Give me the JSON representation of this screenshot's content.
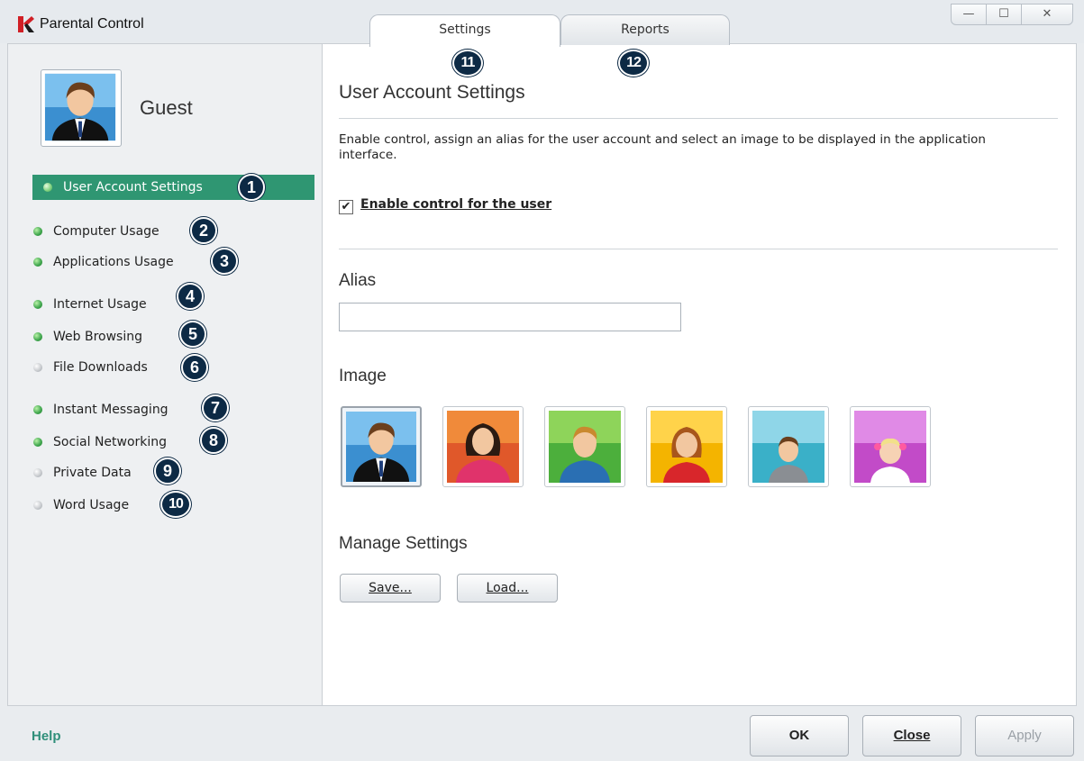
{
  "window": {
    "title": "Parental Control",
    "tabs": [
      {
        "label": "Settings",
        "badge": "11",
        "active": true
      },
      {
        "label": "Reports",
        "badge": "12",
        "active": false
      }
    ],
    "controls": {
      "minimize": "—",
      "maximize": "☐",
      "close": "✕"
    }
  },
  "sidebar": {
    "user_name": "Guest",
    "items": [
      {
        "label": "User Account Settings",
        "badge": "1",
        "status": "active"
      },
      {
        "label": "Computer Usage",
        "badge": "2",
        "status": "on"
      },
      {
        "label": "Applications Usage",
        "badge": "3",
        "status": "on"
      },
      {
        "label": "Internet Usage",
        "badge": "4",
        "status": "on"
      },
      {
        "label": "Web Browsing",
        "badge": "5",
        "status": "on"
      },
      {
        "label": "File Downloads",
        "badge": "6",
        "status": "off"
      },
      {
        "label": "Instant Messaging",
        "badge": "7",
        "status": "on"
      },
      {
        "label": "Social Networking",
        "badge": "8",
        "status": "on"
      },
      {
        "label": "Private Data",
        "badge": "9",
        "status": "off"
      },
      {
        "label": "Word Usage",
        "badge": "10",
        "status": "off"
      }
    ]
  },
  "main": {
    "title": "User Account Settings",
    "description": "Enable control, assign an alias for the user account and select an image to be displayed in the application interface.",
    "enable_control": {
      "label": "Enable control for the user",
      "checked": true,
      "check_glyph": "✔"
    },
    "alias": {
      "heading": "Alias",
      "value": ""
    },
    "image": {
      "heading": "Image",
      "options": [
        {
          "name": "man-suit",
          "bg": "#3b8fd0",
          "selected": true
        },
        {
          "name": "woman-dark-hair",
          "bg": "#e0582a",
          "selected": false
        },
        {
          "name": "boy-green",
          "bg": "#4caf3c",
          "selected": false
        },
        {
          "name": "girl-red",
          "bg": "#f4b400",
          "selected": false
        },
        {
          "name": "child-gray",
          "bg": "#3ab0c8",
          "selected": false
        },
        {
          "name": "toddler-pink",
          "bg": "#c24bc8",
          "selected": false
        }
      ]
    },
    "manage": {
      "heading": "Manage Settings",
      "save_label": "Save...",
      "load_label": "Load..."
    }
  },
  "footer": {
    "help_label": "Help",
    "ok_label": "OK",
    "close_label": "Close",
    "apply_label": "Apply"
  },
  "colors": {
    "accent": "#2f9672",
    "help": "#2f8f7a",
    "badge": "#0d2a45"
  }
}
